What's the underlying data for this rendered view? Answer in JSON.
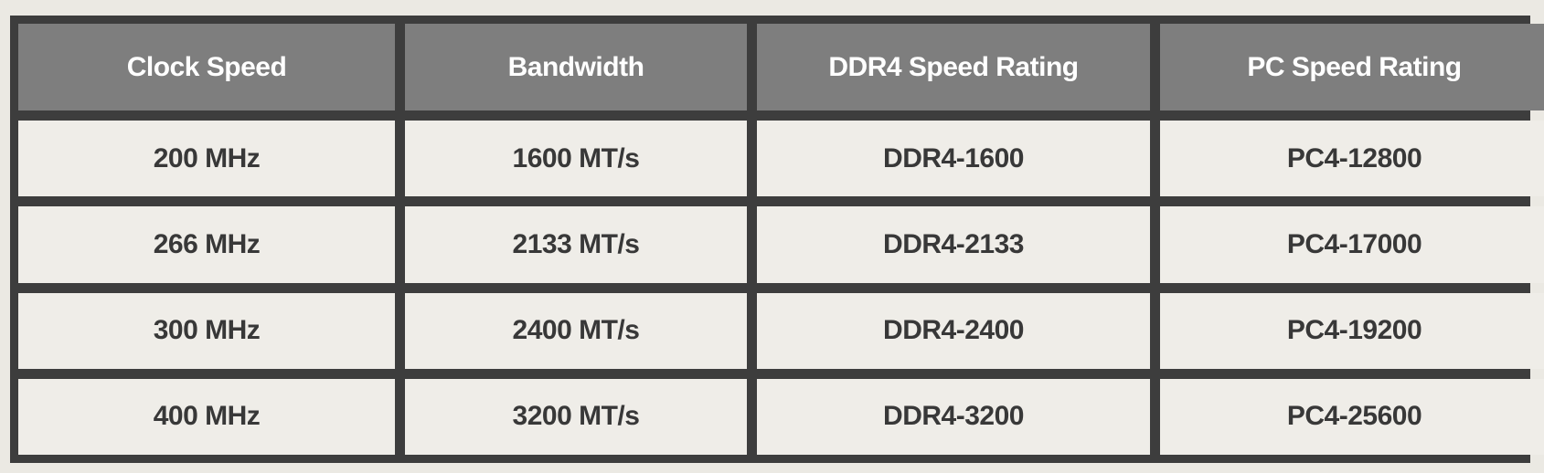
{
  "table": {
    "headers": [
      "Clock Speed",
      "Bandwidth",
      "DDR4 Speed Rating",
      "PC Speed Rating"
    ],
    "rows": [
      [
        "200 MHz",
        "1600 MT/s",
        "DDR4-1600",
        "PC4-12800"
      ],
      [
        "266 MHz",
        "2133 MT/s",
        "DDR4-2133",
        "PC4-17000"
      ],
      [
        "300 MHz",
        "2400 MT/s",
        "DDR4-2400",
        "PC4-19200"
      ],
      [
        "400 MHz",
        "3200 MT/s",
        "DDR4-3200",
        "PC4-25600"
      ]
    ]
  },
  "colors": {
    "page_background": "#ebe9e3",
    "border": "#3d3d3d",
    "header_background": "#7e7e7e",
    "header_text": "#ffffff",
    "cell_background": "#efede8",
    "cell_text": "#383838"
  }
}
